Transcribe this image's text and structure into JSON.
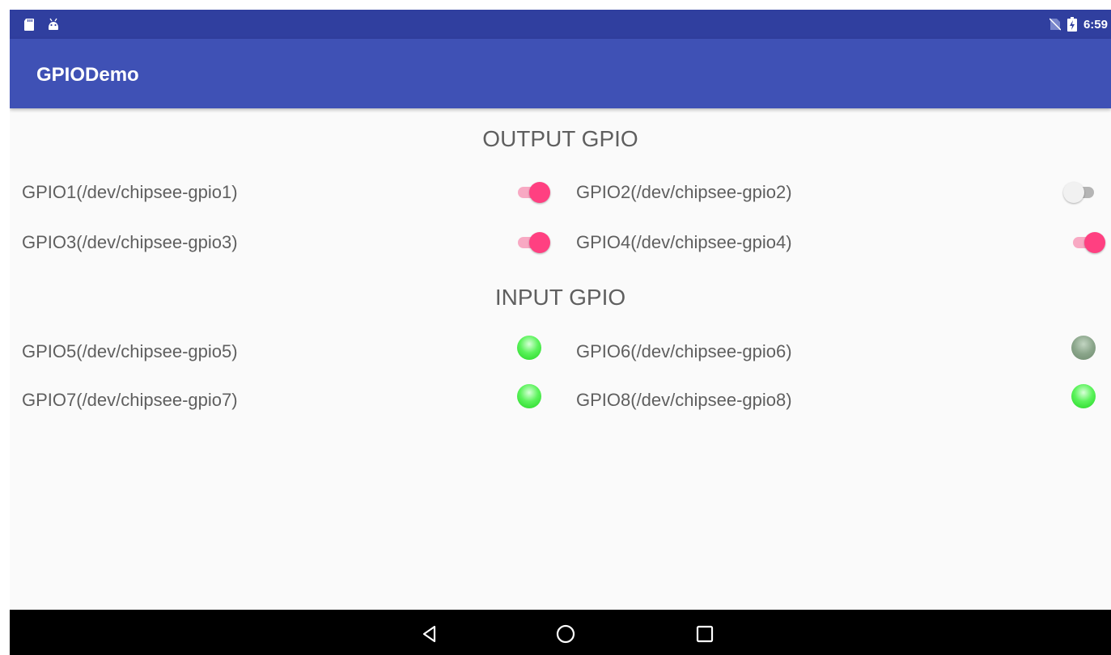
{
  "status_bar": {
    "time": "6:59",
    "icons": [
      "sd-card-icon",
      "android-icon",
      "no-sim-icon",
      "battery-charging-icon"
    ]
  },
  "app_bar": {
    "title": "GPIODemo"
  },
  "output_section": {
    "title": "OUTPUT GPIO",
    "items": [
      {
        "label": "GPIO1(/dev/chipsee-gpio1)",
        "state": "on"
      },
      {
        "label": "GPIO2(/dev/chipsee-gpio2)",
        "state": "off"
      },
      {
        "label": "GPIO3(/dev/chipsee-gpio3)",
        "state": "on"
      },
      {
        "label": "GPIO4(/dev/chipsee-gpio4)",
        "state": "on"
      }
    ]
  },
  "input_section": {
    "title": "INPUT GPIO",
    "items": [
      {
        "label": "GPIO5(/dev/chipsee-gpio5)",
        "state": "high"
      },
      {
        "label": "GPIO6(/dev/chipsee-gpio6)",
        "state": "low"
      },
      {
        "label": "GPIO7(/dev/chipsee-gpio7)",
        "state": "high"
      },
      {
        "label": "GPIO8(/dev/chipsee-gpio8)",
        "state": "high"
      }
    ]
  },
  "colors": {
    "status_bar": "#303f9f",
    "app_bar": "#3f51b5",
    "accent": "#ff4081",
    "led_on": "#33dd33",
    "led_off": "#8aa58a"
  },
  "nav_bar": {
    "buttons": [
      "back-icon",
      "home-icon",
      "recents-icon"
    ]
  }
}
